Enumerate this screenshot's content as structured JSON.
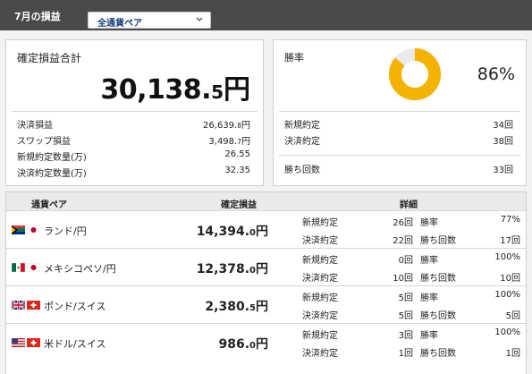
{
  "header": {
    "title": "7月の損益",
    "pair_select": "全通貨ペア"
  },
  "summary": {
    "title": "確定損益合計",
    "total_int": "30,138.",
    "total_dec": "5",
    "total_yen": "円",
    "rows": [
      {
        "label": "決済損益",
        "int": "26,639.",
        "dec": "8",
        "yen": "円"
      },
      {
        "label": "スワップ損益",
        "int": "3,498.",
        "dec": "7",
        "yen": "円"
      },
      {
        "label": "新規約定数量(万)",
        "int": "26.55",
        "dec": "",
        "yen": ""
      },
      {
        "label": "決済約定数量(万)",
        "int": "32.35",
        "dec": "",
        "yen": ""
      }
    ]
  },
  "winrate": {
    "title": "勝率",
    "percent": "86%",
    "value": 0.86,
    "rows": [
      {
        "label": "新規約定",
        "value": "34回"
      },
      {
        "label": "決済約定",
        "value": "38回"
      },
      {
        "label": "勝ち回数",
        "value": "33回"
      }
    ]
  },
  "colors": {
    "accent": "#f5b301",
    "track": "#eaeaea",
    "header_bg": "#4a4a4a"
  },
  "table": {
    "headers": {
      "pair": "通貨ペア",
      "profit": "確定損益",
      "detail": "詳細"
    },
    "rows": [
      {
        "flags": [
          "za-flag-icon",
          "jp-flag-icon"
        ],
        "pair": "ランド/円",
        "profit_int": "14,394.",
        "profit_dec": "0",
        "profit_yen": "円",
        "new_label": "新規約定",
        "new_value": "26回",
        "close_label": "決済約定",
        "close_value": "22回",
        "rate_label": "勝率",
        "rate_value": "77%",
        "wins_label": "勝ち回数",
        "wins_value": "17回"
      },
      {
        "flags": [
          "mx-flag-icon",
          "jp-flag-icon"
        ],
        "pair": "メキシコペソ/円",
        "profit_int": "12,378.",
        "profit_dec": "0",
        "profit_yen": "円",
        "new_label": "新規約定",
        "new_value": "0回",
        "close_label": "決済約定",
        "close_value": "10回",
        "rate_label": "勝率",
        "rate_value": "100%",
        "wins_label": "勝ち回数",
        "wins_value": "10回"
      },
      {
        "flags": [
          "gb-flag-icon",
          "ch-flag-icon"
        ],
        "pair": "ポンド/スイス",
        "profit_int": "2,380.",
        "profit_dec": "5",
        "profit_yen": "円",
        "new_label": "新規約定",
        "new_value": "5回",
        "close_label": "決済約定",
        "close_value": "5回",
        "rate_label": "勝率",
        "rate_value": "100%",
        "wins_label": "勝ち回数",
        "wins_value": "5回"
      },
      {
        "flags": [
          "us-flag-icon",
          "ch-flag-icon"
        ],
        "pair": "米ドル/スイス",
        "profit_int": "986.",
        "profit_dec": "0",
        "profit_yen": "円",
        "new_label": "新規約定",
        "new_value": "3回",
        "close_label": "決済約定",
        "close_value": "1回",
        "rate_label": "勝率",
        "rate_value": "100%",
        "wins_label": "勝ち回数",
        "wins_value": "1回"
      }
    ]
  }
}
